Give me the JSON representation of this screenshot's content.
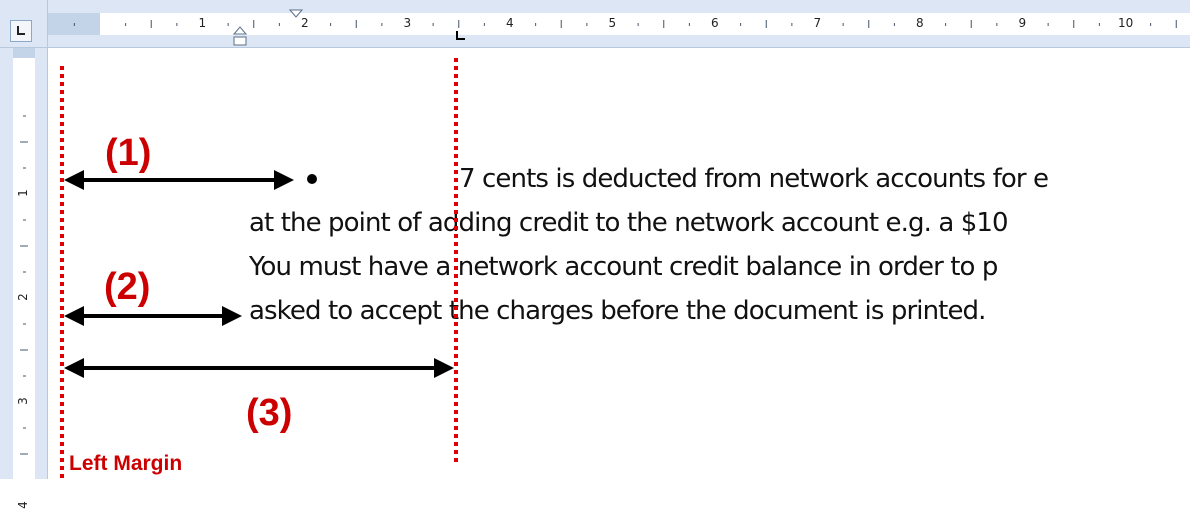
{
  "ruler": {
    "horizontal_numbers": [
      "1",
      "2",
      "3",
      "4",
      "5",
      "6",
      "7",
      "8",
      "9",
      "10"
    ],
    "vertical_numbers": [
      "1",
      "2",
      "3",
      "4"
    ]
  },
  "document": {
    "bullet_symbol": "•",
    "lines": [
      "7 cents is deducted from network accounts for e",
      "at the point of adding credit to the network account e.g. a $10",
      "You must have a network account credit balance in order to p",
      "asked to accept the charges before the document is printed."
    ]
  },
  "annotations": {
    "label1": "(1)",
    "label2": "(2)",
    "label3": "(3)",
    "left_margin": "Left Margin",
    "guide_color": "#e00000",
    "arrow_color": "#000000",
    "label_color": "#cc0000"
  }
}
